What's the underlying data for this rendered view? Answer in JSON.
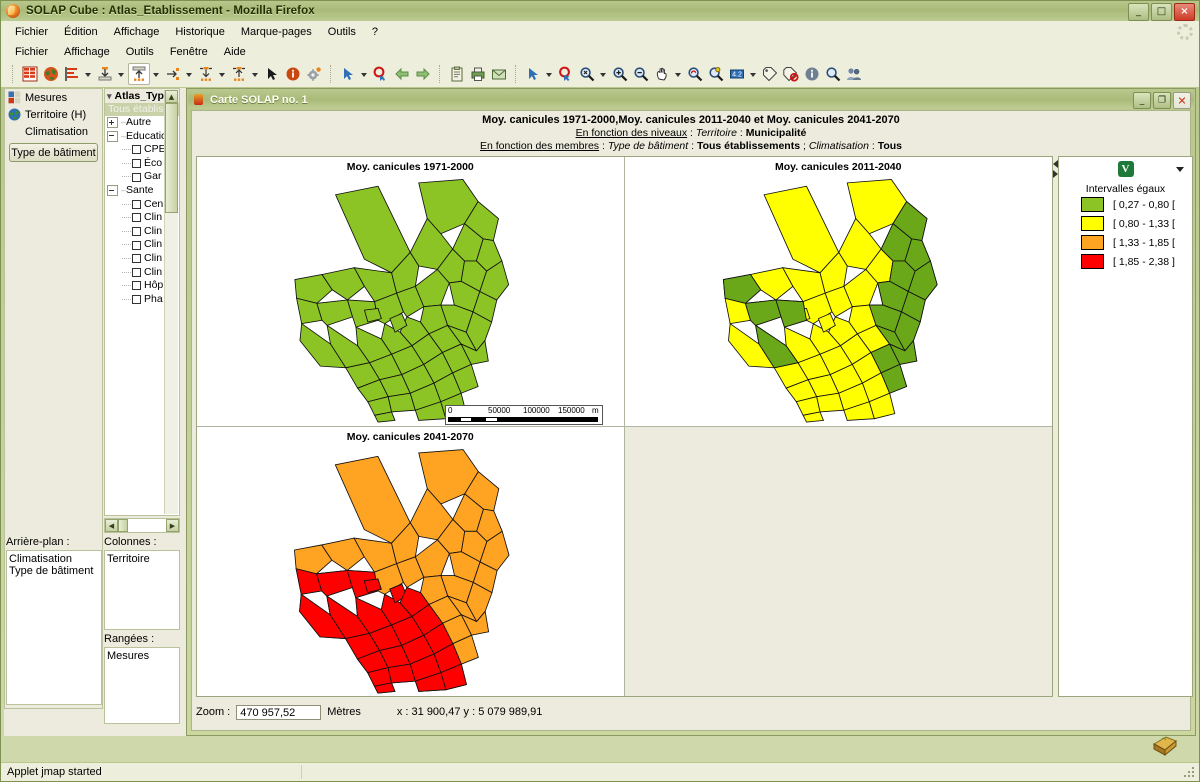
{
  "window": {
    "title": "SOLAP Cube : Atlas_Etablissement - Mozilla Firefox",
    "minimize_label": "_",
    "maximize_label": "□",
    "close_label": "×"
  },
  "browser_menu": [
    {
      "label": "Fichier",
      "accel": "F"
    },
    {
      "label": "Édition",
      "accel": "n"
    },
    {
      "label": "Affichage",
      "accel": "A"
    },
    {
      "label": "Historique",
      "accel": "H"
    },
    {
      "label": "Marque-pages",
      "accel": "M"
    },
    {
      "label": "Outils",
      "accel": "O"
    },
    {
      "label": "?",
      "accel": "?"
    }
  ],
  "app_menu": [
    "Fichier",
    "Affichage",
    "Outils",
    "Fenêtre",
    "Aide"
  ],
  "toolbar": {
    "icons": [
      "table-grid-icon",
      "globe-icon",
      "bar-chart-icon",
      "drill-down-icon",
      "roll-up-icon",
      "drill-across-icon",
      "drill-out-icon",
      "drill-in-icon",
      "arrow-pointer-icon",
      "info-circle-icon",
      "settings-gear-icon",
      "select-pointer-icon",
      "select-target-icon",
      "back-arrow-icon",
      "forward-arrow-icon",
      "clipboard-icon",
      "print-icon",
      "mail-icon",
      "pointer-tool-icon",
      "select-circle-icon",
      "zoom-extent-icon",
      "zoom-in-icon",
      "zoom-out-icon",
      "pan-hand-icon",
      "zoom-previous-icon",
      "zoom-selection-icon",
      "measure-icon",
      "label-icon",
      "label-remove-icon",
      "info-icon",
      "search-icon",
      "users-icon"
    ]
  },
  "dimensions": {
    "items": [
      {
        "label": "Mesures",
        "icon": "measures-icon"
      },
      {
        "label": "Territoire (H)",
        "icon": "globe-icon"
      },
      {
        "label": "Climatisation",
        "icon": "none"
      }
    ],
    "selected_button": "Type de bâtiment"
  },
  "tree": {
    "header": "Atlas_Typ",
    "selected": "Tous établisse",
    "nodes": [
      {
        "label": "Autre",
        "depth": 0,
        "type": "expandable",
        "state": "collapsed"
      },
      {
        "label": "Education",
        "depth": 0,
        "type": "expandable",
        "state": "expanded"
      },
      {
        "label": "CPE",
        "depth": 1,
        "type": "leaf"
      },
      {
        "label": "Éco",
        "depth": 1,
        "type": "leaf"
      },
      {
        "label": "Gar",
        "depth": 1,
        "type": "leaf"
      },
      {
        "label": "Sante",
        "depth": 0,
        "type": "expandable",
        "state": "expanded"
      },
      {
        "label": "Cen",
        "depth": 1,
        "type": "leaf"
      },
      {
        "label": "Clin",
        "depth": 1,
        "type": "leaf"
      },
      {
        "label": "Clin",
        "depth": 1,
        "type": "leaf"
      },
      {
        "label": "Clin",
        "depth": 1,
        "type": "leaf"
      },
      {
        "label": "Clin",
        "depth": 1,
        "type": "leaf"
      },
      {
        "label": "Clin",
        "depth": 1,
        "type": "leaf"
      },
      {
        "label": "Hôp",
        "depth": 1,
        "type": "leaf"
      },
      {
        "label": "Pha",
        "depth": 1,
        "type": "leaf"
      }
    ]
  },
  "panels": {
    "background_label": "Arrière-plan :",
    "background_items": [
      "Climatisation",
      "Type de bâtiment"
    ],
    "columns_label": "Colonnes :",
    "columns_items": [
      "Territoire"
    ],
    "rows_label": "Rangées :",
    "rows_items": [
      "Mesures"
    ]
  },
  "map_window": {
    "title": "Carte SOLAP no. 1",
    "minimize_label": "_",
    "restore_label": "❐",
    "close_label": "✕",
    "header": {
      "line1": "Moy. canicules 1971-2000,Moy. canicules 2011-2040 et Moy. canicules 2041-2070",
      "line2_prefix": "En fonction des niveaux",
      "line2_dim": "Territoire",
      "line2_value": "Municipalité",
      "line3_prefix": "En fonction des membres",
      "line3_dim1": "Type de bâtiment",
      "line3_val1": "Tous établissements",
      "line3_dim2": "Climatisation",
      "line3_val2": "Tous"
    },
    "maps": [
      {
        "title": "Moy. canicules 1971-2000",
        "class": "green"
      },
      {
        "title": "Moy. canicules 2011-2040",
        "class": "yellow"
      },
      {
        "title": "Moy. canicules 2041-2070",
        "class": "orange"
      }
    ],
    "scalebar": {
      "ticks": [
        "0",
        "50000",
        "100000",
        "150000"
      ],
      "unit": "m"
    },
    "status": {
      "zoom_label": "Zoom :",
      "zoom_value": "470 957,52",
      "unit": "Mètres",
      "coords": "x : 31 900,47  y : 5 079 989,91"
    }
  },
  "legend": {
    "badge": "V",
    "title": "Intervalles égaux",
    "classes": [
      {
        "range": "[ 0,27 - 0,80 [",
        "color": "#8cc425"
      },
      {
        "range": "[ 0,80 - 1,33 [",
        "color": "#ffff00"
      },
      {
        "range": "[ 1,33 - 1,85 [",
        "color": "#ffa323"
      },
      {
        "range": "[ 1,85 - 2,38 ]",
        "color": "#ff0000"
      }
    ]
  },
  "status_bar": {
    "message": "Applet jmap started"
  },
  "chart_data": {
    "type": "map",
    "title": "Moy. canicules 1971-2000, Moy. canicules 2011-2040 et Moy. canicules 2041-2070",
    "classification": "Intervalles égaux",
    "legend_breaks": [
      0.27,
      0.8,
      1.33,
      1.85,
      2.38
    ],
    "legend_colors": [
      "#8cc425",
      "#ffff00",
      "#ffa323",
      "#ff0000"
    ],
    "panels": [
      {
        "title": "Moy. canicules 1971-2000",
        "dominant_class": "[ 0,27 - 0,80 [",
        "dominant_color": "#8cc425"
      },
      {
        "title": "Moy. canicules 2011-2040",
        "dominant_class": "[ 0,80 - 1,33 [",
        "dominant_color": "#ffff00",
        "secondary_class": "[ 0,27 - 0,80 [",
        "secondary_color": "#8cc425"
      },
      {
        "title": "Moy. canicules 2041-2070",
        "dominant_class": "[ 1,33 - 1,85 [",
        "dominant_color": "#ffa323",
        "secondary_class": "[ 1,85 - 2,38 ]",
        "secondary_color": "#ff0000"
      }
    ],
    "geography": "Municipalité",
    "scale_unit": "Mètres",
    "scale_max": 150000
  }
}
